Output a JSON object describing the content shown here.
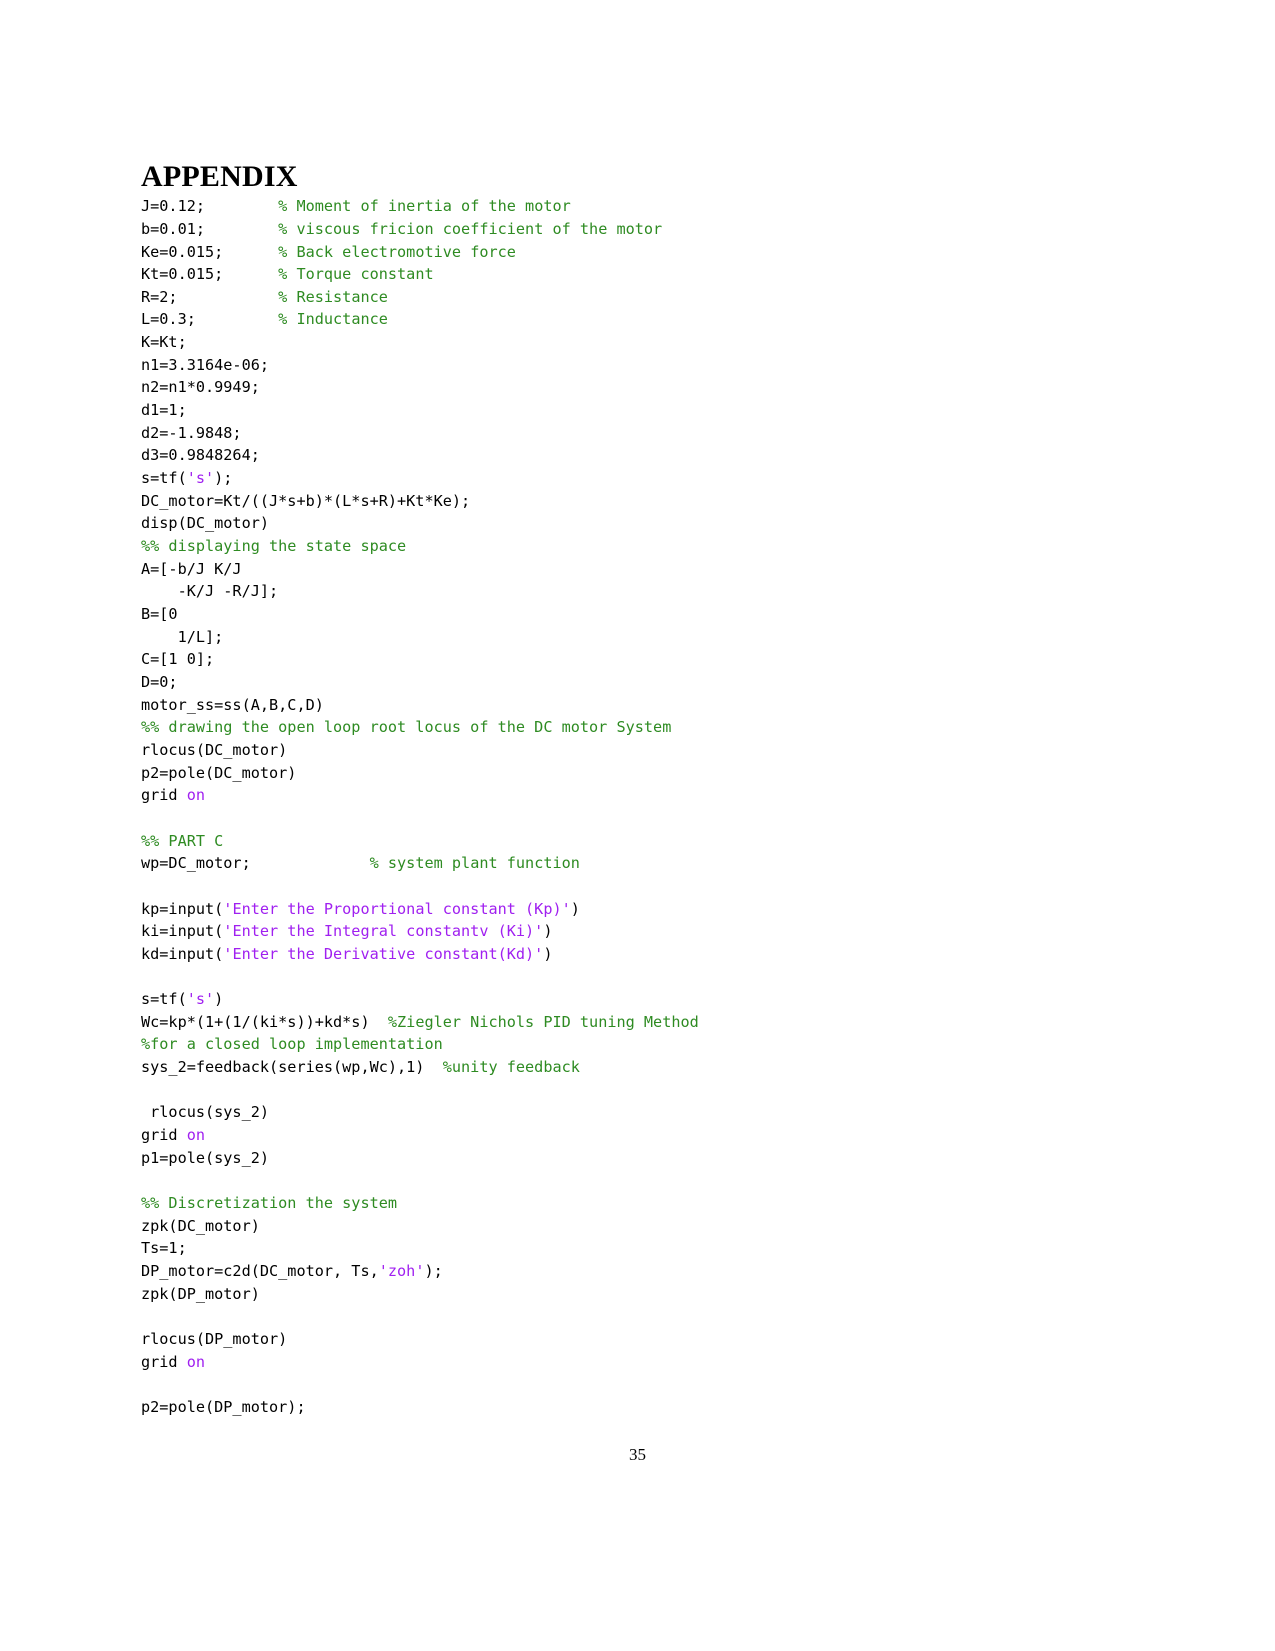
{
  "document": {
    "heading": "APPENDIX",
    "page_number": "35",
    "background_color": "#ffffff",
    "colors": {
      "code": "#000000",
      "comment": "#2E8B22",
      "string": "#A020F0",
      "keyword": "#A020F0"
    }
  },
  "code_listing": {
    "language": "MATLAB",
    "lines": [
      {
        "id": "L01",
        "segments": [
          {
            "type": "code",
            "text": "J=0.12;"
          },
          {
            "type": "code",
            "text": "        "
          },
          {
            "type": "comment",
            "text": "% Moment of inertia of the motor"
          }
        ]
      },
      {
        "id": "L02",
        "segments": [
          {
            "type": "code",
            "text": "b=0.01;"
          },
          {
            "type": "code",
            "text": "        "
          },
          {
            "type": "comment",
            "text": "% viscous fricion coefficient of the motor"
          }
        ]
      },
      {
        "id": "L03",
        "segments": [
          {
            "type": "code",
            "text": "Ke=0.015;"
          },
          {
            "type": "code",
            "text": "      "
          },
          {
            "type": "comment",
            "text": "% Back electromotive force"
          }
        ]
      },
      {
        "id": "L04",
        "segments": [
          {
            "type": "code",
            "text": "Kt=0.015;"
          },
          {
            "type": "code",
            "text": "      "
          },
          {
            "type": "comment",
            "text": "% Torque constant"
          }
        ]
      },
      {
        "id": "L05",
        "segments": [
          {
            "type": "code",
            "text": "R=2;"
          },
          {
            "type": "code",
            "text": "           "
          },
          {
            "type": "comment",
            "text": "% Resistance"
          }
        ]
      },
      {
        "id": "L06",
        "segments": [
          {
            "type": "code",
            "text": "L=0.3;"
          },
          {
            "type": "code",
            "text": "         "
          },
          {
            "type": "comment",
            "text": "% Inductance"
          }
        ]
      },
      {
        "id": "L07",
        "segments": [
          {
            "type": "code",
            "text": "K=Kt;"
          }
        ]
      },
      {
        "id": "L08",
        "segments": [
          {
            "type": "code",
            "text": "n1=3.3164e-06;"
          }
        ]
      },
      {
        "id": "L09",
        "segments": [
          {
            "type": "code",
            "text": "n2=n1*0.9949;"
          }
        ]
      },
      {
        "id": "L10",
        "segments": [
          {
            "type": "code",
            "text": "d1=1;"
          }
        ]
      },
      {
        "id": "L11",
        "segments": [
          {
            "type": "code",
            "text": "d2=-1.9848;"
          }
        ]
      },
      {
        "id": "L12",
        "segments": [
          {
            "type": "code",
            "text": "d3=0.9848264;"
          }
        ]
      },
      {
        "id": "L13",
        "segments": [
          {
            "type": "code",
            "text": "s=tf("
          },
          {
            "type": "string",
            "text": "'s'"
          },
          {
            "type": "code",
            "text": ");"
          }
        ]
      },
      {
        "id": "L14",
        "segments": [
          {
            "type": "code",
            "text": "DC_motor=Kt/((J*s+b)*(L*s+R)+Kt*Ke);"
          }
        ]
      },
      {
        "id": "L15",
        "segments": [
          {
            "type": "code",
            "text": "disp(DC_motor)"
          }
        ]
      },
      {
        "id": "L16",
        "segments": [
          {
            "type": "comment",
            "text": "%% displaying the state space"
          }
        ]
      },
      {
        "id": "L17",
        "segments": [
          {
            "type": "code",
            "text": "A=[-b/J K/J"
          }
        ]
      },
      {
        "id": "L18",
        "segments": [
          {
            "type": "code",
            "text": "    -K/J -R/J];"
          }
        ]
      },
      {
        "id": "L19",
        "segments": [
          {
            "type": "code",
            "text": "B=[0"
          }
        ]
      },
      {
        "id": "L20",
        "segments": [
          {
            "type": "code",
            "text": "    1/L];"
          }
        ]
      },
      {
        "id": "L21",
        "segments": [
          {
            "type": "code",
            "text": "C=[1 0];"
          }
        ]
      },
      {
        "id": "L22",
        "segments": [
          {
            "type": "code",
            "text": "D=0;"
          }
        ]
      },
      {
        "id": "L23",
        "segments": [
          {
            "type": "code",
            "text": "motor_ss=ss(A,B,C,D)"
          }
        ]
      },
      {
        "id": "L24",
        "segments": [
          {
            "type": "comment",
            "text": "%% drawing the open loop root locus of the DC motor System"
          }
        ]
      },
      {
        "id": "L25",
        "segments": [
          {
            "type": "code",
            "text": "rlocus(DC_motor)"
          }
        ]
      },
      {
        "id": "L26",
        "segments": [
          {
            "type": "code",
            "text": "p2=pole(DC_motor)"
          }
        ]
      },
      {
        "id": "L27",
        "segments": [
          {
            "type": "code",
            "text": "grid "
          },
          {
            "type": "keyword",
            "text": "on"
          }
        ]
      },
      {
        "id": "L28",
        "segments": []
      },
      {
        "id": "L29",
        "segments": [
          {
            "type": "comment",
            "text": "%% PART C"
          }
        ]
      },
      {
        "id": "L30",
        "segments": [
          {
            "type": "code",
            "text": "wp=DC_motor;"
          },
          {
            "type": "code",
            "text": "             "
          },
          {
            "type": "comment",
            "text": "% system plant function"
          }
        ]
      },
      {
        "id": "L31",
        "segments": []
      },
      {
        "id": "L32",
        "segments": [
          {
            "type": "code",
            "text": "kp=input("
          },
          {
            "type": "string",
            "text": "'Enter the Proportional constant (Kp)'"
          },
          {
            "type": "code",
            "text": ")"
          }
        ]
      },
      {
        "id": "L33",
        "segments": [
          {
            "type": "code",
            "text": "ki=input("
          },
          {
            "type": "string",
            "text": "'Enter the Integral constantv (Ki)'"
          },
          {
            "type": "code",
            "text": ")"
          }
        ]
      },
      {
        "id": "L34",
        "segments": [
          {
            "type": "code",
            "text": "kd=input("
          },
          {
            "type": "string",
            "text": "'Enter the Derivative constant(Kd)'"
          },
          {
            "type": "code",
            "text": ")"
          }
        ]
      },
      {
        "id": "L35",
        "segments": []
      },
      {
        "id": "L36",
        "segments": [
          {
            "type": "code",
            "text": "s=tf("
          },
          {
            "type": "string",
            "text": "'s'"
          },
          {
            "type": "code",
            "text": ")"
          }
        ]
      },
      {
        "id": "L37",
        "segments": [
          {
            "type": "code",
            "text": "Wc=kp*(1+(1/(ki*s))+kd*s)  "
          },
          {
            "type": "comment",
            "text": "%Ziegler Nichols PID tuning Method"
          }
        ]
      },
      {
        "id": "L38",
        "segments": [
          {
            "type": "comment",
            "text": "%for a closed loop implementation"
          }
        ]
      },
      {
        "id": "L39",
        "segments": [
          {
            "type": "code",
            "text": "sys_2=feedback(series(wp,Wc),1)  "
          },
          {
            "type": "comment",
            "text": "%unity feedback"
          }
        ]
      },
      {
        "id": "L40",
        "segments": []
      },
      {
        "id": "L41",
        "segments": [
          {
            "type": "code",
            "text": " rlocus(sys_2)"
          }
        ]
      },
      {
        "id": "L42",
        "segments": [
          {
            "type": "code",
            "text": "grid "
          },
          {
            "type": "keyword",
            "text": "on"
          }
        ]
      },
      {
        "id": "L43",
        "segments": [
          {
            "type": "code",
            "text": "p1=pole(sys_2)"
          }
        ]
      },
      {
        "id": "L44",
        "segments": []
      },
      {
        "id": "L45",
        "segments": [
          {
            "type": "comment",
            "text": "%% Discretization the system"
          }
        ]
      },
      {
        "id": "L46",
        "segments": [
          {
            "type": "code",
            "text": "zpk(DC_motor)"
          }
        ]
      },
      {
        "id": "L47",
        "segments": [
          {
            "type": "code",
            "text": "Ts=1;"
          }
        ]
      },
      {
        "id": "L48",
        "segments": [
          {
            "type": "code",
            "text": "DP_motor=c2d(DC_motor, Ts,"
          },
          {
            "type": "string",
            "text": "'zoh'"
          },
          {
            "type": "code",
            "text": ");"
          }
        ]
      },
      {
        "id": "L49",
        "segments": [
          {
            "type": "code",
            "text": "zpk(DP_motor)"
          }
        ]
      },
      {
        "id": "L50",
        "segments": []
      },
      {
        "id": "L51",
        "segments": [
          {
            "type": "code",
            "text": "rlocus(DP_motor)"
          }
        ]
      },
      {
        "id": "L52",
        "segments": [
          {
            "type": "code",
            "text": "grid "
          },
          {
            "type": "keyword",
            "text": "on"
          }
        ]
      },
      {
        "id": "L53",
        "segments": []
      },
      {
        "id": "L54",
        "segments": [
          {
            "type": "code",
            "text": "p2=pole(DP_motor);"
          }
        ]
      }
    ]
  }
}
